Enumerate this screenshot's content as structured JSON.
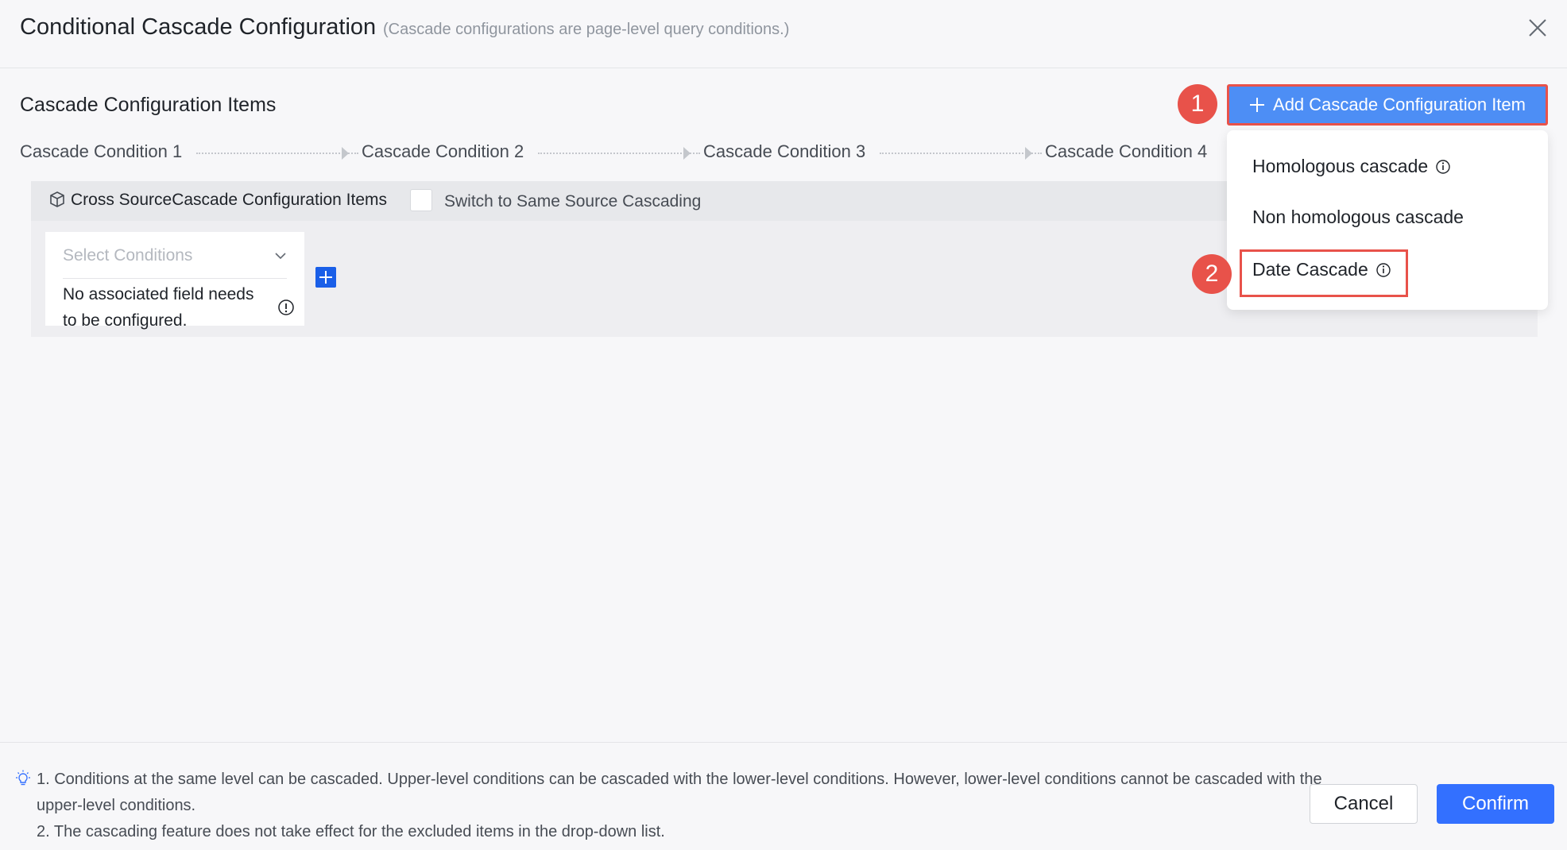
{
  "dialog": {
    "title": "Conditional Cascade Configuration",
    "subtitle": "(Cascade configurations are page-level query conditions.)"
  },
  "section": {
    "title": "Cascade Configuration Items",
    "add_button_label": "Add Cascade Configuration Item"
  },
  "markers": {
    "one": "1",
    "two": "2"
  },
  "steps": [
    "Cascade Condition 1",
    "Cascade Condition 2",
    "Cascade Condition 3",
    "Cascade Condition 4"
  ],
  "panel": {
    "label": "Cross SourceCascade Configuration Items",
    "switch_label": "Switch to Same Source Cascading",
    "select_placeholder": "Select Conditions",
    "note": "No associated field needs to be configured."
  },
  "dropdown": {
    "items": [
      "Homologous cascade",
      "Non homologous cascade",
      "Date Cascade"
    ]
  },
  "footer": {
    "note_1": "1. Conditions at the same level can be cascaded. Upper-level conditions can be cascaded with the lower-level conditions. However, lower-level conditions cannot be cascaded with the upper-level conditions.",
    "note_2": "2. The cascading feature does not take effect for the excluded items in the drop-down list.",
    "cancel_label": "Cancel",
    "confirm_label": "Confirm"
  },
  "colors": {
    "primary": "#3370ff",
    "add_button": "#4d8ef5",
    "highlight": "#e8524a"
  },
  "icons": [
    "close-icon",
    "plus-icon",
    "cube-icon",
    "chevron-down-icon",
    "info-icon",
    "plus-square-icon",
    "bulb-icon"
  ]
}
